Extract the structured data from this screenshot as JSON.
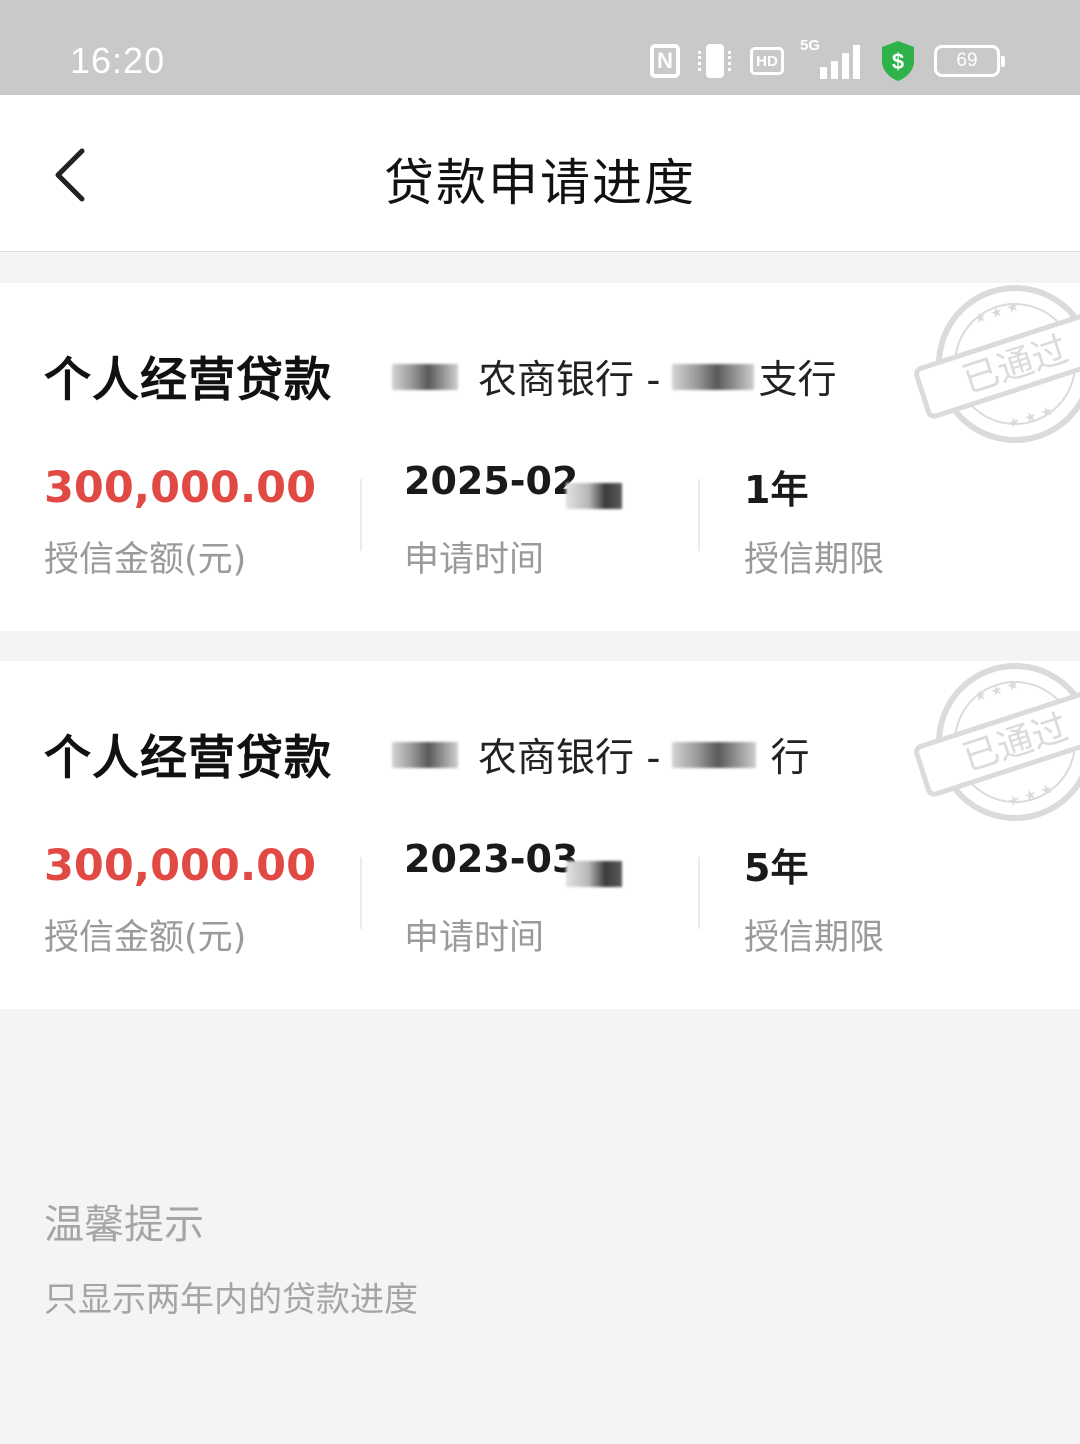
{
  "status_bar": {
    "time": "16:20",
    "network_label": "5G",
    "hd_label": "HD",
    "nfc_label": "N",
    "battery_level": "69",
    "icons": [
      "nfc-icon",
      "vibrate-icon",
      "hd-icon",
      "signal-5g-icon",
      "security-shield-icon",
      "battery-icon"
    ]
  },
  "nav": {
    "title": "贷款申请进度",
    "back_icon": "chevron-left-icon"
  },
  "loans": [
    {
      "name": "个人经营贷款",
      "bank_mid": "农商银行 -",
      "bank_tail": "支行",
      "amount": "300,000.00",
      "amount_label": "授信金额(元)",
      "date": "2025-02",
      "date_label": "申请时间",
      "term": "1年",
      "term_label": "授信期限",
      "stamp_text": "已通过"
    },
    {
      "name": "个人经营贷款",
      "bank_mid": "农商银行 -",
      "bank_tail": "行",
      "amount": "300,000.00",
      "amount_label": "授信金额(元)",
      "date": "2023-03",
      "date_label": "申请时间",
      "term": "5年",
      "term_label": "授信期限",
      "stamp_text": "已通过"
    }
  ],
  "tips": {
    "title": "温馨提示",
    "text": "只显示两年内的贷款进度"
  },
  "colors": {
    "amount": "#e14a44",
    "status_bar_bg": "#c9c9c9",
    "page_bg": "#f4f4f4",
    "label_gray": "#9a9a9a",
    "shield_green": "#2db34a"
  }
}
